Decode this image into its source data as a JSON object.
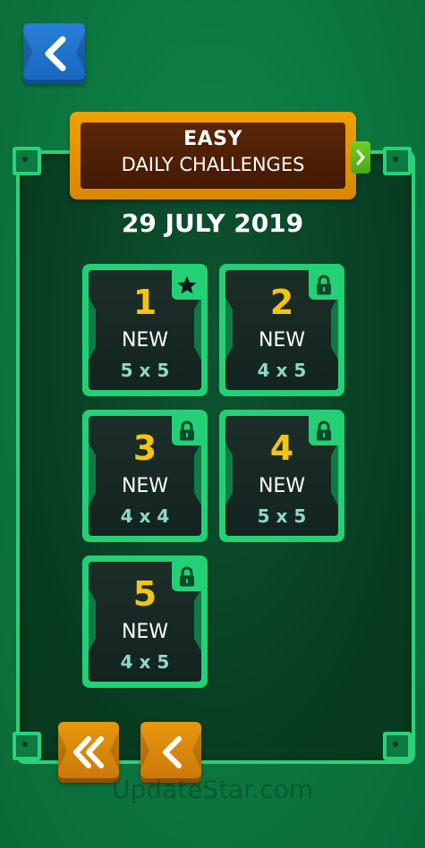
{
  "header": {
    "difficulty": "EASY",
    "mode": "DAILY CHALLENGES"
  },
  "date": "29 JULY 2019",
  "levels": [
    {
      "number": "1",
      "status": "NEW",
      "size": "5 x 5",
      "badge_icon": "star-icon"
    },
    {
      "number": "2",
      "status": "NEW",
      "size": "4 x 5",
      "badge_icon": "lock-icon"
    },
    {
      "number": "3",
      "status": "NEW",
      "size": "4 x 4",
      "badge_icon": "lock-icon"
    },
    {
      "number": "4",
      "status": "NEW",
      "size": "5 x 5",
      "badge_icon": "lock-icon"
    },
    {
      "number": "5",
      "status": "NEW",
      "size": "4 x 5",
      "badge_icon": "lock-icon"
    }
  ],
  "nav": {
    "back_icon": "chevron-left-icon",
    "first_icon": "double-chevron-left-icon",
    "prev_icon": "chevron-left-icon",
    "next_icon": "chevron-right-icon"
  },
  "watermark": "UpdateStar.com",
  "colors": {
    "background": "#0d7a42",
    "frame": "#2bd178",
    "plaque": "#f0a000",
    "level_number": "#f2c511",
    "back_button": "#1f72cc"
  }
}
